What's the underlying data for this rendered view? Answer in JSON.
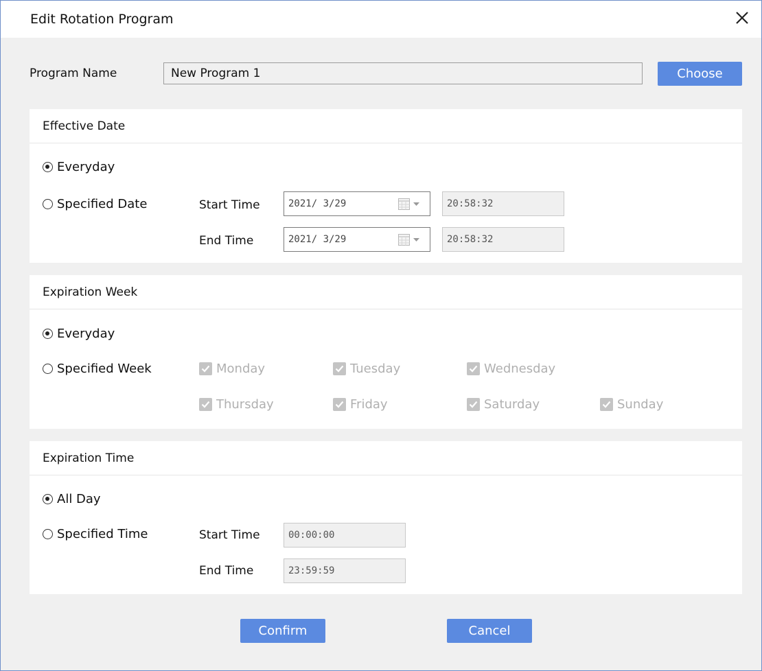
{
  "dialog": {
    "title": "Edit Rotation Program",
    "close_icon": "close-icon",
    "program_name_label": "Program Name",
    "program_name_value": "New Program 1",
    "choose_label": "Choose"
  },
  "effective_date": {
    "header": "Effective Date",
    "everyday_label": "Everyday",
    "specified_label": "Specified Date",
    "selected": "everyday",
    "start_time_label": "Start Time",
    "start_date": "2021/ 3/29",
    "start_time": "20:58:32",
    "end_time_label": "End Time",
    "end_date": "2021/ 3/29",
    "end_time": "20:58:32"
  },
  "expiration_week": {
    "header": "Expiration Week",
    "everyday_label": "Everyday",
    "specified_label": "Specified Week",
    "selected": "everyday",
    "days": [
      "Monday",
      "Tuesday",
      "Wednesday",
      "Thursday",
      "Friday",
      "Saturday",
      "Sunday"
    ]
  },
  "expiration_time": {
    "header": "Expiration Time",
    "all_day_label": "All Day",
    "specified_label": "Specified Time",
    "selected": "all_day",
    "start_time_label": "Start Time",
    "start_time": "00:00:00",
    "end_time_label": "End Time",
    "end_time": "23:59:59"
  },
  "footer": {
    "confirm_label": "Confirm",
    "cancel_label": "Cancel"
  },
  "colors": {
    "accent": "#5b8ae0",
    "border": "#6e8fc9",
    "background": "#f0f0f0",
    "disabled_text": "#b0b0b0"
  }
}
